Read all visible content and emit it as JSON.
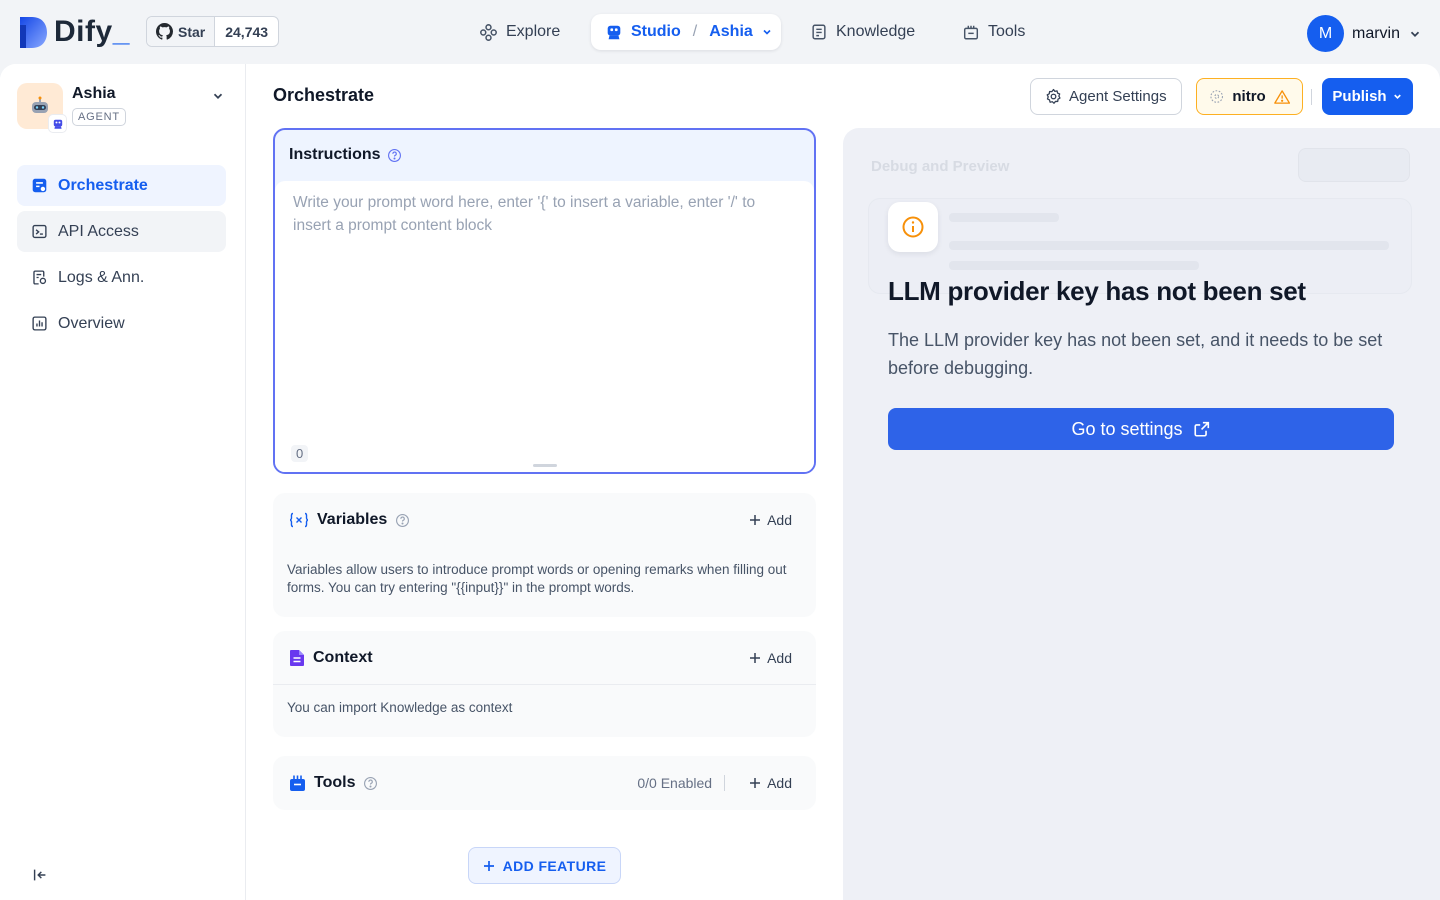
{
  "brand": {
    "name": "Dify",
    "cursor": "_"
  },
  "github": {
    "star_label": "Star",
    "star_count": "24,743"
  },
  "nav": {
    "explore": "Explore",
    "studio": "Studio",
    "separator": "/",
    "current_app": "Ashia",
    "knowledge": "Knowledge",
    "tools": "Tools"
  },
  "user": {
    "initial": "M",
    "name": "marvin"
  },
  "app": {
    "name": "Ashia",
    "type": "AGENT"
  },
  "sidebar": {
    "items": [
      {
        "label": "Orchestrate",
        "icon": "orchestrate-icon"
      },
      {
        "label": "API Access",
        "icon": "terminal-icon"
      },
      {
        "label": "Logs & Ann.",
        "icon": "logs-icon"
      },
      {
        "label": "Overview",
        "icon": "chart-icon"
      }
    ]
  },
  "orchestrate": {
    "title": "Orchestrate",
    "agent_settings": "Agent Settings",
    "model": "nitro",
    "publish": "Publish",
    "instructions": {
      "title": "Instructions",
      "placeholder": "Write your prompt word here, enter '{' to insert a variable, enter '/' to insert a prompt content block",
      "count": "0"
    },
    "variables": {
      "title": "Variables",
      "add": "Add",
      "desc": "Variables allow users to introduce prompt words or opening remarks when filling out forms. You can try entering \"{{input}}\" in the prompt words."
    },
    "context": {
      "title": "Context",
      "add": "Add",
      "desc": "You can import Knowledge as context"
    },
    "tools": {
      "title": "Tools",
      "enabled": "0/0 Enabled",
      "add": "Add"
    },
    "add_feature": "ADD FEATURE"
  },
  "debug": {
    "bg_title": "Debug and Preview",
    "warning_title": "LLM provider key has not been set",
    "warning_desc": "The LLM provider key has not been set, and it needs to be set before debugging.",
    "go_settings": "Go to settings"
  },
  "colors": {
    "primary": "#155eef",
    "warning": "#f79009",
    "instructions_border": "#6172f3"
  }
}
